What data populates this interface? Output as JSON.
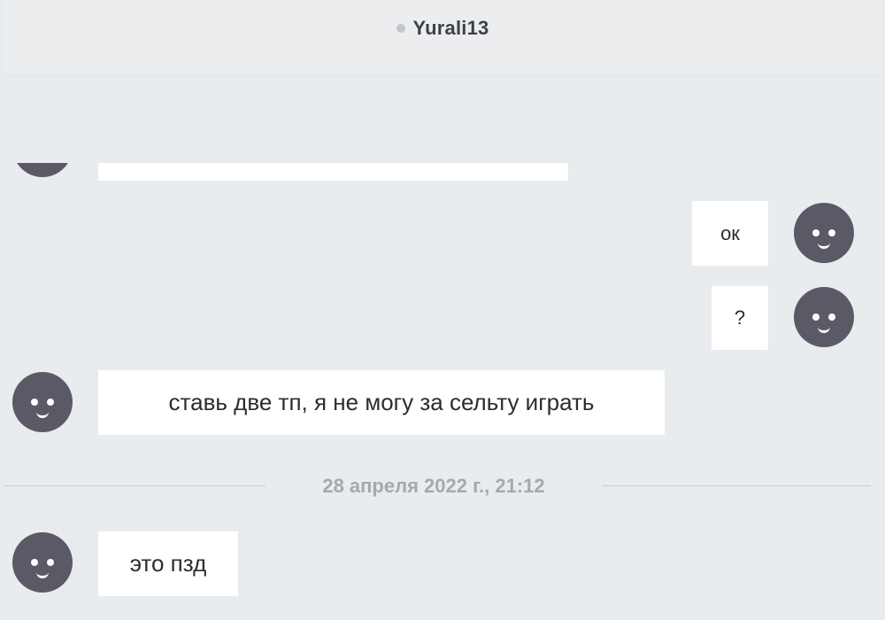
{
  "header": {
    "username": "Yurali13"
  },
  "messages": [
    {
      "side": "left",
      "text": ""
    },
    {
      "side": "right",
      "text": "ок"
    },
    {
      "side": "right",
      "text": "?"
    },
    {
      "side": "left",
      "text": "ставь две тп, я не могу за сельту играть"
    },
    {
      "side": "left",
      "text": "это пзд"
    }
  ],
  "divider": {
    "date": "28 апреля 2022 г., 21:12"
  },
  "colors": {
    "background": "#e9ecee",
    "avatar": "#5c5966",
    "bubble": "#ffffff",
    "status_offline": "#c2c6cc"
  }
}
